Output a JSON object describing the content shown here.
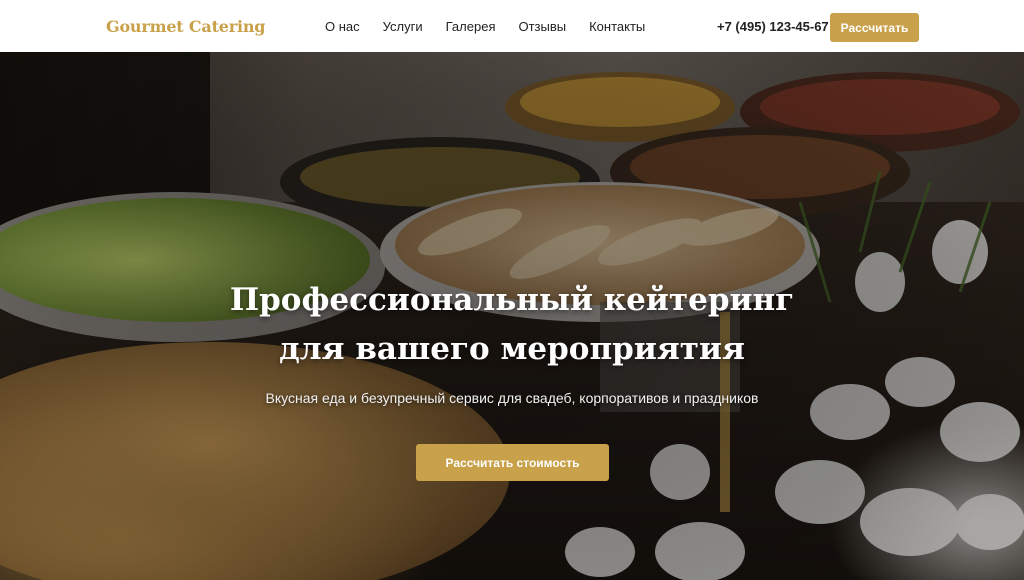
{
  "header": {
    "logo": "Gourmet Catering",
    "nav": [
      "О нас",
      "Услуги",
      "Галерея",
      "Отзывы",
      "Контакты"
    ],
    "phone": "+7 (495) 123-45-67",
    "cta_label": "Рассчитать"
  },
  "hero": {
    "title_line1": "Профессиональный кейтеринг",
    "title_line2": "для вашего мероприятия",
    "subtitle": "Вкусная еда и безупречный сервис для свадеб, корпоративов и праздников",
    "cta_label": "Рассчитать стоимость"
  },
  "colors": {
    "accent": "#c9a14a",
    "header_bg": "#ffffff",
    "nav_text": "#222222"
  }
}
